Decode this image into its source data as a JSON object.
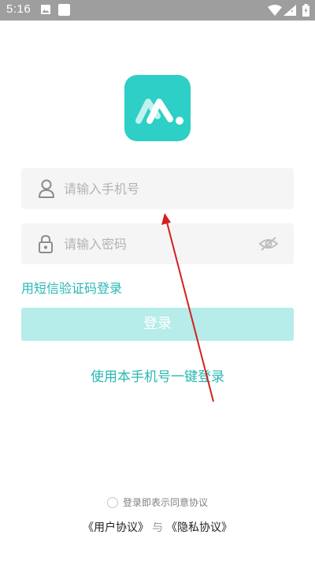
{
  "status_bar": {
    "time": "5:16"
  },
  "login": {
    "username_placeholder": "请输入手机号",
    "password_placeholder": "请输入密码",
    "sms_login_link": "用短信验证码登录",
    "login_button": "登录",
    "one_key_login": "使用本手机号一键登录"
  },
  "agreement": {
    "consent_text": "登录即表示同意协议",
    "user_agreement": "《用户协议》",
    "separator": "与",
    "privacy_policy": "《隐私协议》"
  },
  "colors": {
    "accent": "#27b8b3",
    "logo": "#2dcfc6",
    "login_button_bg": "#b6ece9",
    "annotation_arrow": "#d32020"
  }
}
